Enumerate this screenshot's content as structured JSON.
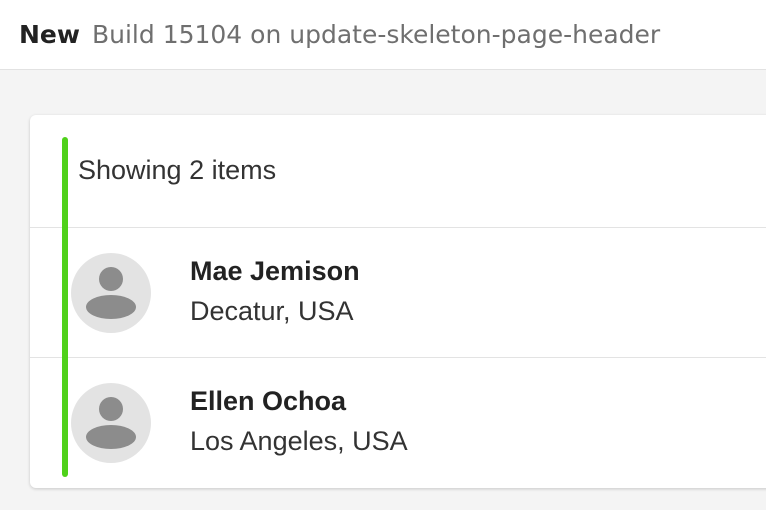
{
  "header": {
    "status": "New",
    "build_text": "Build 15104 on update-skeleton-page-header"
  },
  "list": {
    "count_text": "Showing 2 items",
    "accent_color": "#4fd11a",
    "items": [
      {
        "name": "Mae Jemison",
        "location": "Decatur, USA",
        "avatar_icon": "person-icon"
      },
      {
        "name": "Ellen Ochoa",
        "location": "Los Angeles, USA",
        "avatar_icon": "person-icon"
      }
    ]
  }
}
